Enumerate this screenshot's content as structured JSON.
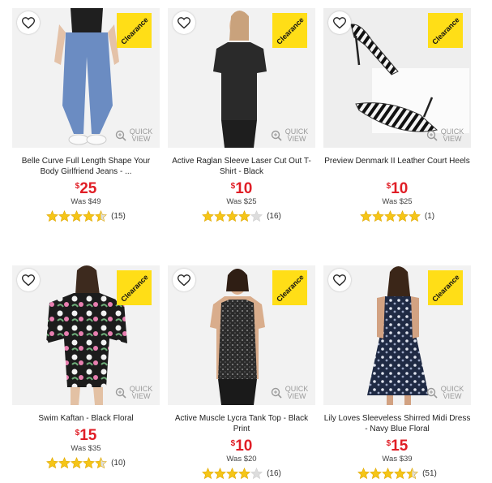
{
  "products": [
    {
      "name": "Belle Curve Full Length Shape Your Body Girlfriend Jeans - ...",
      "price": "25",
      "was": "Was $49",
      "rating": 4.5,
      "reviews": "(15)",
      "badge": "Clearance",
      "quick_view": "QUICK VIEW",
      "wishlist_icon": "heart-icon"
    },
    {
      "name": "Active Raglan Sleeve Laser Cut Out T-Shirt - Black",
      "price": "10",
      "was": "Was $25",
      "rating": 4,
      "reviews": "(16)",
      "badge": "Clearance",
      "quick_view": "QUICK VIEW",
      "wishlist_icon": "heart-icon"
    },
    {
      "name": "Preview Denmark II Leather Court Heels",
      "price": "10",
      "was": "Was $25",
      "rating": 5,
      "reviews": "(1)",
      "badge": "Clearance",
      "quick_view": "QUICK VIEW",
      "wishlist_icon": "heart-icon"
    },
    {
      "name": "Swim Kaftan - Black Floral",
      "price": "15",
      "was": "Was $35",
      "rating": 4.5,
      "reviews": "(10)",
      "badge": "Clearance",
      "quick_view": "QUICK VIEW",
      "wishlist_icon": "heart-icon"
    },
    {
      "name": "Active Muscle Lycra Tank Top - Black Print",
      "price": "10",
      "was": "Was $20",
      "rating": 4,
      "reviews": "(16)",
      "badge": "Clearance",
      "quick_view": "QUICK VIEW",
      "wishlist_icon": "heart-icon"
    },
    {
      "name": "Lily Loves Sleeveless Shirred Midi Dress - Navy Blue Floral",
      "price": "15",
      "was": "Was $39",
      "rating": 4.5,
      "reviews": "(51)",
      "badge": "Clearance",
      "quick_view": "QUICK VIEW",
      "wishlist_icon": "heart-icon"
    }
  ],
  "currency_symbol": "$",
  "colors": {
    "price": "#e01e26",
    "badge": "#ffde17",
    "star": "#f5c518",
    "star_empty": "#dddddd"
  }
}
